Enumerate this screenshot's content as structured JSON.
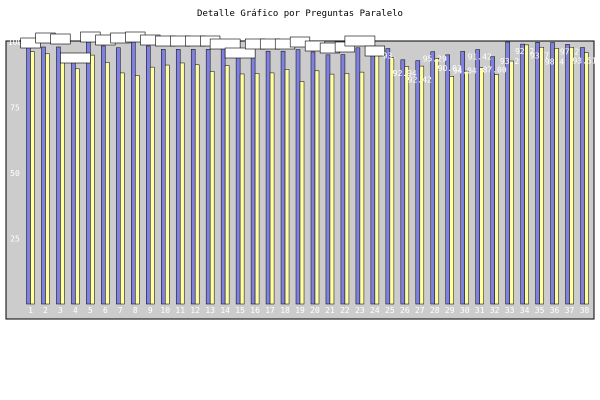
{
  "chart_data": {
    "type": "bar",
    "title": "Detalle Gráfico por Preguntas Paralelo",
    "xlabel": "",
    "ylabel": "",
    "ylim": [
      0,
      100
    ],
    "yticks": [
      25,
      50,
      75,
      100
    ],
    "grid": false,
    "categories": [
      "1",
      "2",
      "3",
      "4",
      "5",
      "6",
      "7",
      "8",
      "9",
      "10",
      "11",
      "12",
      "13",
      "14",
      "15",
      "16",
      "17",
      "18",
      "19",
      "20",
      "21",
      "22",
      "23",
      "24",
      "25",
      "26",
      "27",
      "28",
      "29",
      "30",
      "31",
      "32",
      "33",
      "34",
      "35",
      "36",
      "37",
      "38"
    ],
    "series": [
      {
        "values": [
          100,
          98.1,
          98.1,
          95.2,
          100,
          98.5,
          97.8,
          100,
          98.5,
          97.2,
          97.2,
          97.2,
          97.2,
          97.8,
          96.67,
          96.5,
          96.5,
          96.5,
          97.1,
          96.2,
          95.1,
          95.2,
          97.78,
          96.4,
          97.5,
          93.2,
          92.9,
          96.3,
          95.1,
          96.4,
          97.1,
          94.4,
          100,
          99.2,
          99.9,
          99.8,
          99.1,
          97.9
        ],
        "color": "#8080e0"
      },
      {
        "values": [
          96.3,
          95.5,
          94.3,
          89.77,
          95.0,
          92.2,
          88.2,
          87.2,
          90.4,
          91.2,
          92.0,
          91.3,
          88.77,
          91.0,
          87.8,
          88.0,
          88.21,
          89.51,
          84.91,
          89.0,
          87.74,
          88.0,
          88.5,
          95.4,
          94.0,
          90.6,
          90.8,
          93.8,
          86.9,
          88.9,
          90.2,
          87.56,
          92.73,
          98.9,
          98.0,
          97.6,
          98.0,
          95.9
        ],
        "color": "#ffffa0"
      }
    ],
    "data_labels": [
      "100",
      "98.",
      "98.",
      "92.77",
      "100",
      "98.",
      "98.",
      "100",
      "98.",
      "97.",
      "97.",
      "97.",
      "97.",
      "96.67",
      "95.55",
      "96.",
      "96.",
      "96.",
      "97.",
      "96.",
      "95.",
      "95.",
      "97.78",
      "94.",
      "93.",
      "92.94",
      "92.42",
      "95.29",
      "90.03",
      "94.04",
      "91.42",
      "87.00",
      "93.2",
      "92.2",
      "93.7",
      "98.4",
      "97.2",
      "93.51"
    ],
    "colors": {
      "plot_background": "#cccccc",
      "frame": "#000000",
      "tick_text": "#ffffff",
      "label_box": "#ffffff"
    }
  }
}
